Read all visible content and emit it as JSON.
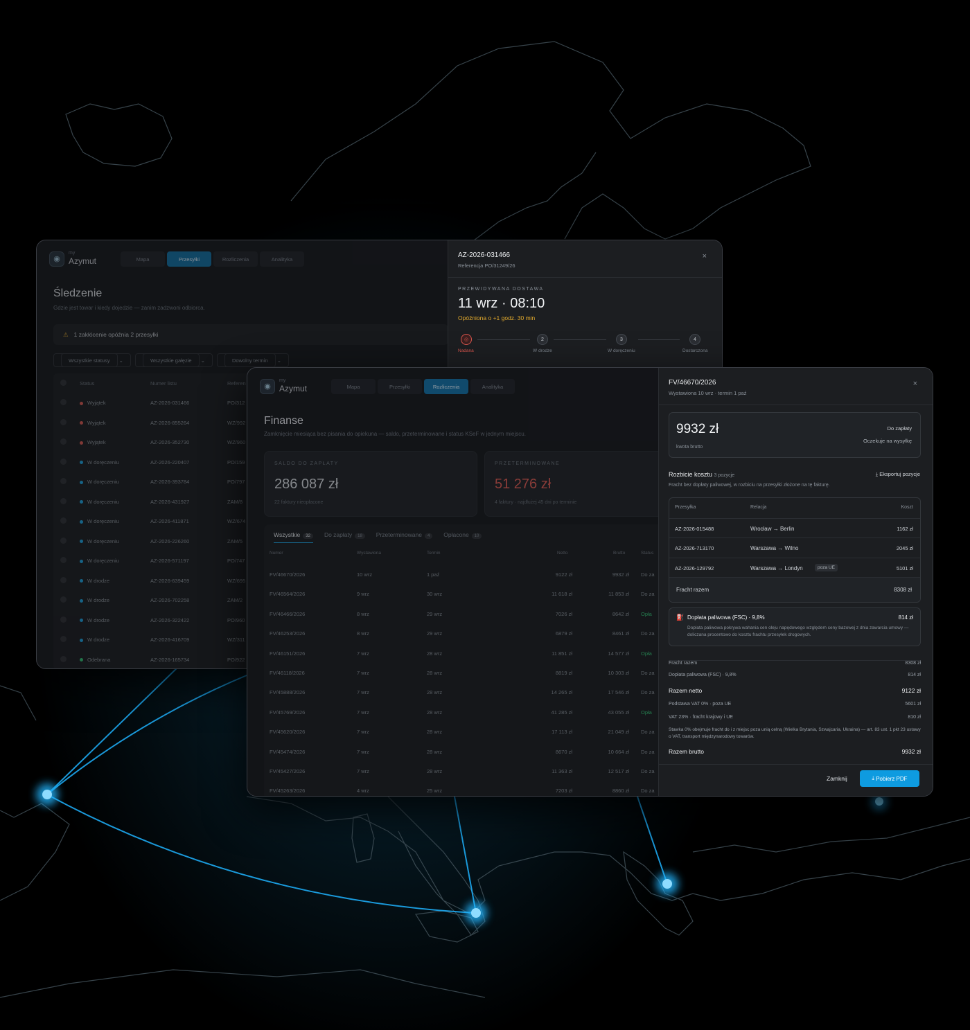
{
  "tracking": {
    "brand": {
      "pre": "my",
      "name": "Azymut"
    },
    "nav": [
      "Mapa",
      "Przesyłki",
      "Rozliczenia",
      "Analityka"
    ],
    "title": "Śledzenie",
    "subtitle": "Gdzie jest towar i kiedy dojedzie — zanim zadzwoni odbiorca.",
    "alert": "1 zakłócenie opóźnia 2 przesyłki",
    "filters": [
      "Wszystkie statusy",
      "Wszystkie gałęzie",
      "Dowolny termin"
    ],
    "headers": [
      "Status",
      "Numer listu",
      "Referen"
    ],
    "rows": [
      {
        "status": "Wyjątek",
        "num": "AZ-2026-031466",
        "ref": "PO/312"
      },
      {
        "status": "Wyjątek",
        "num": "AZ-2026-855264",
        "ref": "WZ/992"
      },
      {
        "status": "Wyjątek",
        "num": "AZ-2026-352730",
        "ref": "WZ/960"
      },
      {
        "status": "W doręczeniu",
        "num": "AZ-2026-220407",
        "ref": "PO/159"
      },
      {
        "status": "W doręczeniu",
        "num": "AZ-2026-393784",
        "ref": "PO/797"
      },
      {
        "status": "W doręczeniu",
        "num": "AZ-2026-431927",
        "ref": "ZAM/8"
      },
      {
        "status": "W doręczeniu",
        "num": "AZ-2026-411871",
        "ref": "WZ/674"
      },
      {
        "status": "W doręczeniu",
        "num": "AZ-2026-226260",
        "ref": "ZAM/5"
      },
      {
        "status": "W doręczeniu",
        "num": "AZ-2026-571197",
        "ref": "PO/747"
      },
      {
        "status": "W drodze",
        "num": "AZ-2026-639459",
        "ref": "WZ/695"
      },
      {
        "status": "W drodze",
        "num": "AZ-2026-702258",
        "ref": "ZAM/2"
      },
      {
        "status": "W drodze",
        "num": "AZ-2026-322422",
        "ref": "PO/960"
      },
      {
        "status": "W drodze",
        "num": "AZ-2026-416709",
        "ref": "WZ/311"
      },
      {
        "status": "Odebrana",
        "num": "AZ-2026-165734",
        "ref": "PO/922"
      }
    ],
    "detail": {
      "id": "AZ-2026-031466",
      "ref": "Referencja PO/31249/26",
      "cap": "PRZEWIDYWANA DOSTAWA",
      "eta": "11 wrz · 08:10",
      "delay": "Opóźniona o +1 godz. 30 min",
      "steps": [
        {
          "n": "",
          "l": "Nadana"
        },
        {
          "n": "2",
          "l": "W drodze"
        },
        {
          "n": "3",
          "l": "W doręczeniu"
        },
        {
          "n": "4",
          "l": "Dostarczona"
        }
      ],
      "close": "×"
    }
  },
  "finance": {
    "brand": {
      "pre": "my",
      "name": "Azymut"
    },
    "nav": [
      "Mapa",
      "Przesyłki",
      "Rozliczenia",
      "Analityka"
    ],
    "title": "Finanse",
    "subtitle": "Zamknięcie miesiąca bez pisania do opiekuna — saldo, przeterminowane i status KSeF w jednym miejscu.",
    "kpi1": {
      "label": "SALDO DO ZAPŁATY",
      "value": "286 087 zł",
      "note": "22 faktury nieopłacone"
    },
    "kpi2": {
      "label": "PRZETERMINOWANE",
      "value": "51 276 zł",
      "note": "4 faktury · najdłużej 45 dni po terminie"
    },
    "tabs": [
      {
        "l": "Wszystkie",
        "c": "32"
      },
      {
        "l": "Do zapłaty",
        "c": "18"
      },
      {
        "l": "Przeterminowane",
        "c": "4"
      },
      {
        "l": "Opłacone",
        "c": "10"
      }
    ],
    "headers": [
      "Numer",
      "Wystawiona",
      "Termin",
      "Netto",
      "Brutto",
      "Status"
    ],
    "rows": [
      [
        "FV/46670/2026",
        "10 wrz",
        "1 paź",
        "9122 zł",
        "9932 zł",
        "Do za"
      ],
      [
        "FV/46564/2026",
        "9 wrz",
        "30 wrz",
        "11 618 zł",
        "11 853 zł",
        "Do za"
      ],
      [
        "FV/46466/2026",
        "8 wrz",
        "29 wrz",
        "7026 zł",
        "8642 zł",
        "Opła"
      ],
      [
        "FV/46253/2026",
        "8 wrz",
        "29 wrz",
        "6879 zł",
        "8461 zł",
        "Do za"
      ],
      [
        "FV/46151/2026",
        "7 wrz",
        "28 wrz",
        "11 851 zł",
        "14 577 zł",
        "Opła"
      ],
      [
        "FV/46118/2026",
        "7 wrz",
        "28 wrz",
        "8819 zł",
        "10 303 zł",
        "Do za"
      ],
      [
        "FV/45888/2026",
        "7 wrz",
        "28 wrz",
        "14 265 zł",
        "17 546 zł",
        "Do za"
      ],
      [
        "FV/45769/2026",
        "7 wrz",
        "28 wrz",
        "41 285 zł",
        "43 055 zł",
        "Opła"
      ],
      [
        "FV/45620/2026",
        "7 wrz",
        "28 wrz",
        "17 113 zł",
        "21 049 zł",
        "Do za"
      ],
      [
        "FV/45474/2026",
        "7 wrz",
        "28 wrz",
        "8670 zł",
        "10 664 zł",
        "Do za"
      ],
      [
        "FV/45427/2026",
        "7 wrz",
        "28 wrz",
        "11 363 zł",
        "12 517 zł",
        "Do za"
      ],
      [
        "FV/45263/2026",
        "4 wrz",
        "25 wrz",
        "7203 zł",
        "8860 zł",
        "Do za"
      ]
    ],
    "invoice": {
      "id": "FV/46670/2026",
      "meta": "Wystawiona 10 wrz · termin 1 paź",
      "close": "×",
      "amount": "9932 zł",
      "amount_note": "kwota brutto",
      "status1": "Do zapłaty",
      "status2": "Oczekuje na wysyłkę",
      "bd_title": "Rozbicie kosztu",
      "bd_count": "3 pozycje",
      "export": "Eksportuj pozycje",
      "bd_desc": "Fracht bez dopłaty paliwowej, w rozbiciu na przesyłki złożone na tę fakturę.",
      "bd_headers": [
        "Przesyłka",
        "Relacja",
        "Koszt"
      ],
      "bd_rows": [
        {
          "id": "AZ-2026-015488",
          "rel": "Wrocław → Berlin",
          "tag": "",
          "cost": "1162 zł"
        },
        {
          "id": "AZ-2026-713170",
          "rel": "Warszawa → Wilno",
          "tag": "",
          "cost": "2045 zł"
        },
        {
          "id": "AZ-2026-129792",
          "rel": "Warszawa → Londyn",
          "tag": "poza UE",
          "cost": "5101 zł"
        }
      ],
      "bd_total_l": "Fracht razem",
      "bd_total_v": "8308 zł",
      "fsc_title": "Dopłata paliwowa (FSC) · 9,8%",
      "fsc_value": "814 zł",
      "fsc_desc": "Dopłata paliwowa pokrywa wahania cen oleju napędowego względem ceny bazowej z dnia zawarcia umowy — doliczana procentowo do kosztu frachtu przesyłek drogowych.",
      "s1l": "Fracht razem",
      "s1v": "8308 zł",
      "s2l": "Dopłata paliwowa (FSC) · 9,8%",
      "s2v": "814 zł",
      "s3l": "Razem netto",
      "s3v": "9122 zł",
      "s4l": "Podstawa VAT 0% · poza UE",
      "s4v": "5601 zł",
      "s5l": "VAT 23% · fracht krajowy i UE",
      "s5v": "810 zł",
      "note": "Stawka 0% obejmuje fracht do i z miejsc poza unią celną (Wielka Brytania, Szwajcaria, Ukraina) — art. 83 ust. 1 pkt 23 ustawy o VAT, transport międzynarodowy towarów.",
      "s6l": "Razem brutto",
      "s6v": "9932 zł",
      "btn_close": "Zamknij",
      "btn_pdf": "Pobierz PDF"
    }
  },
  "colors": {
    "accent": "#0e9be0",
    "glow": "#22b6ff",
    "warn": "#e1a92d",
    "danger": "#d9564e",
    "ok": "#2fbf71"
  }
}
